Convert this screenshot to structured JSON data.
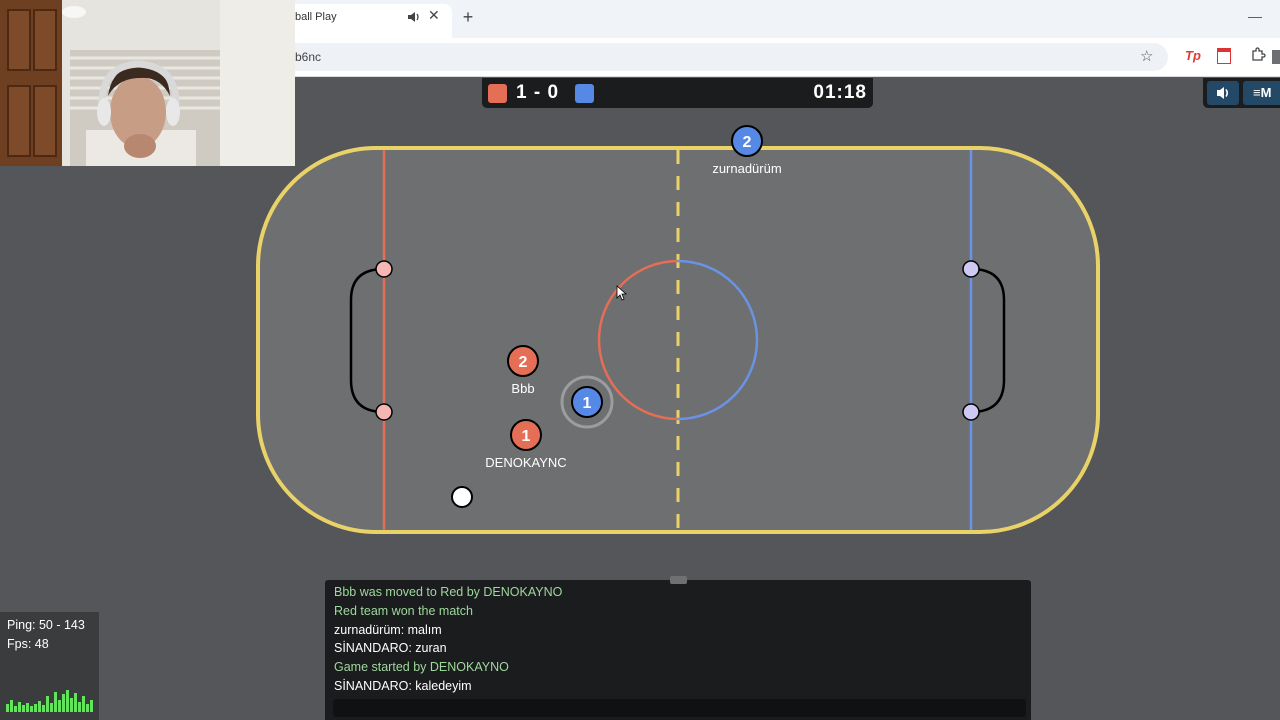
{
  "browser": {
    "tab_title": "ball Play",
    "url": "b6nc",
    "newtab_label": "+",
    "close_glyph": "✕",
    "minimize_glyph": "—",
    "star_glyph": "☆",
    "ext_tp_label": "Tp",
    "icons": [
      "speaker-icon",
      "close-icon",
      "star-icon",
      "puzzle-icon"
    ]
  },
  "scoreboard": {
    "score": "1 - 0",
    "timer": "01:18",
    "red_color": "#e56e56",
    "blue_color": "#5689e5",
    "menu_label": "≡M"
  },
  "field": {
    "border_color": "#e9d268",
    "surface_color": "#6e6f71",
    "red_line_color": "#e56e56",
    "blue_line_color": "#6b93e5",
    "ball_color": "#ffffff"
  },
  "players": [
    {
      "team": "blue",
      "avatar": "2",
      "name": "zurnadürüm"
    },
    {
      "team": "red",
      "avatar": "2",
      "name": "Bbb"
    },
    {
      "team": "blue",
      "avatar": "1",
      "name": ""
    },
    {
      "team": "red",
      "avatar": "1",
      "name": "DENOKAYNC"
    }
  ],
  "stats": {
    "ping": "Ping: 50 - 143",
    "fps": "Fps: 48"
  },
  "chat": {
    "messages": [
      {
        "type": "system",
        "text": "Bbb was moved to Red by DENOKAYNO"
      },
      {
        "type": "system",
        "text": "Red team won the match"
      },
      {
        "type": "user",
        "text": "zurnadürüm: malım"
      },
      {
        "type": "user",
        "text": "SİNANDARO: zuran"
      },
      {
        "type": "system",
        "text": "Game started by DENOKAYNO"
      },
      {
        "type": "user",
        "text": "SİNANDARO: kaledeyim"
      }
    ],
    "input_value": ""
  }
}
